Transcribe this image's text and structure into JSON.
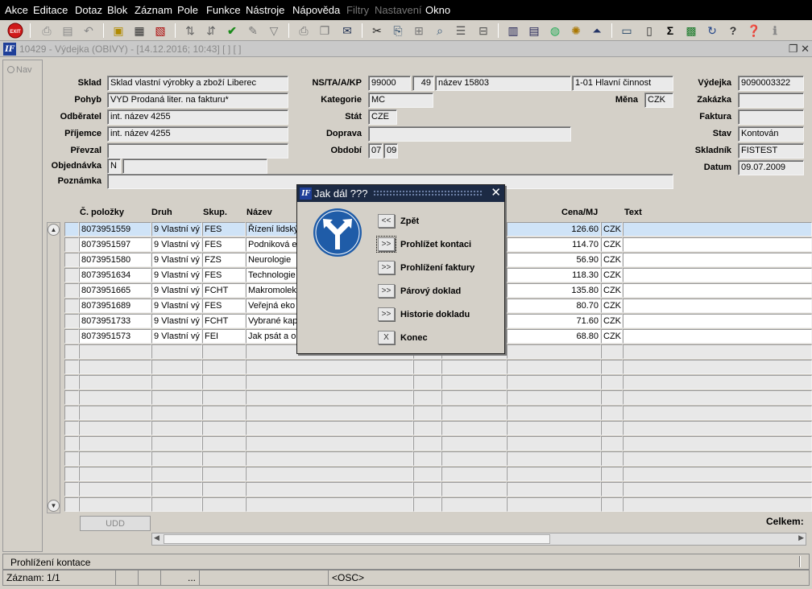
{
  "menu": [
    "Akce",
    "Editace",
    "Dotaz",
    "Blok",
    "Záznam",
    "Pole",
    "Funkce",
    "Nástroje",
    "Nápověda",
    "Filtry",
    "Nastavení",
    "Okno"
  ],
  "toolbar": {
    "exit_label": "EXIT",
    "icons": [
      "exit-icon",
      "print-icon",
      "save-icon",
      "undo-icon",
      "query-enter-icon",
      "query-execute-icon",
      "query-cancel-icon",
      "sort-asc-icon",
      "sort-desc-icon",
      "confirm-icon",
      "tools-icon",
      "filter-icon",
      "printer-icon",
      "copy-icon",
      "mail-icon",
      "cut-icon",
      "paste-icon",
      "tree-icon",
      "search-icon",
      "list-icon",
      "structure-icon",
      "calc-icon",
      "form-icon",
      "globe-icon",
      "settings-icon",
      "upload-icon",
      "chart-icon",
      "sum-icon",
      "excel-icon",
      "refresh-icon",
      "help-icon",
      "info-icon"
    ]
  },
  "window": {
    "title": "10429 - Výdejka (OBIVY) - [14.12.2016; 10:43] [ ] [ ]",
    "logo": "IF"
  },
  "nav": {
    "label": "Nav"
  },
  "header": {
    "sklad": {
      "label": "Sklad",
      "value": "Sklad vlastní výrobky a zboží Liberec"
    },
    "pohyb": {
      "label": "Pohyb",
      "value": "VYD Prodaná liter. na fakturu*"
    },
    "odberatel": {
      "label": "Odběratel",
      "value": "int. název 4255"
    },
    "prijemce": {
      "label": "Příjemce",
      "value": "int. název 4255"
    },
    "prevzal": {
      "label": "Převzal",
      "value": ""
    },
    "objednavka": {
      "label": "Objednávka",
      "value": "N",
      "value2": ""
    },
    "poznamka": {
      "label": "Poznámka",
      "value": ""
    },
    "ns": {
      "label": "NS/TA/A/KP",
      "v1": "99000",
      "v2": "49",
      "v3": "název 15803",
      "v4": "1-01 Hlavní činnost"
    },
    "kategorie": {
      "label": "Kategorie",
      "value": "MC"
    },
    "mena": {
      "label": "Měna",
      "value": "CZK"
    },
    "stat": {
      "label": "Stát",
      "value": "CZE"
    },
    "doprava": {
      "label": "Doprava",
      "value": ""
    },
    "obdobi": {
      "label": "Období",
      "v1": "07",
      "v2": "09"
    },
    "vydejka": {
      "label": "Výdejka",
      "value": "9090003322"
    },
    "zakazka": {
      "label": "Zakázka",
      "value": ""
    },
    "faktura": {
      "label": "Faktura",
      "value": ""
    },
    "stav": {
      "label": "Stav",
      "value": "Kontován"
    },
    "skladnik": {
      "label": "Skladník",
      "value": "FISTEST"
    },
    "datum": {
      "label": "Datum",
      "value": "09.07.2009"
    }
  },
  "grid": {
    "columns": {
      "polozka": "Č. položky",
      "druh": "Druh",
      "skup": "Skup.",
      "nazev": "Název",
      "cena": "Cena/MJ",
      "text": "Text"
    },
    "rows": [
      {
        "polozka": "8073951559",
        "druh": "9 Vlastní vý",
        "skup": "FES",
        "nazev": "Řízení lidský",
        "cena": "126.60",
        "mena": "CZK"
      },
      {
        "polozka": "8073951597",
        "druh": "9 Vlastní vý",
        "skup": "FES",
        "nazev": "Podniková e",
        "cena": "114.70",
        "mena": "CZK"
      },
      {
        "polozka": "8073951580",
        "druh": "9 Vlastní vý",
        "skup": "FZS",
        "nazev": "Neurologie",
        "cena": "56.90",
        "mena": "CZK"
      },
      {
        "polozka": "8073951634",
        "druh": "9 Vlastní vý",
        "skup": "FES",
        "nazev": "Technologie",
        "cena": "118.30",
        "mena": "CZK"
      },
      {
        "polozka": "8073951665",
        "druh": "9 Vlastní vý",
        "skup": "FCHT",
        "nazev": "Makromoleku",
        "cena": "135.80",
        "mena": "CZK"
      },
      {
        "polozka": "8073951689",
        "druh": "9 Vlastní vý",
        "skup": "FES",
        "nazev": "Veřejná eko",
        "cena": "80.70",
        "mena": "CZK"
      },
      {
        "polozka": "8073951733",
        "druh": "9 Vlastní vý",
        "skup": "FCHT",
        "nazev": "Vybrané kap",
        "cena": "71.60",
        "mena": "CZK"
      },
      {
        "polozka": "8073951573",
        "druh": "9 Vlastní vý",
        "skup": "FEI",
        "nazev": "Jak psát a o",
        "cena": "68.80",
        "mena": "CZK"
      }
    ],
    "udd_label": "UDD",
    "celkem_label": "Celkem:"
  },
  "dialog": {
    "title": "Jak dál ???",
    "options": [
      {
        "btn": "<<",
        "label": "Zpět"
      },
      {
        "btn": ">>",
        "label": "Prohlížet kontaci"
      },
      {
        "btn": ">>",
        "label": "Prohlížení faktury"
      },
      {
        "btn": ">>",
        "label": "Párový doklad"
      },
      {
        "btn": ">>",
        "label": "Historie dokladu"
      },
      {
        "btn": "X",
        "label": "Konec"
      }
    ]
  },
  "status": {
    "message": "Prohlížení kontace",
    "record": "Záznam: 1/1",
    "ellipsis": "...",
    "mode": "<OSC>"
  }
}
